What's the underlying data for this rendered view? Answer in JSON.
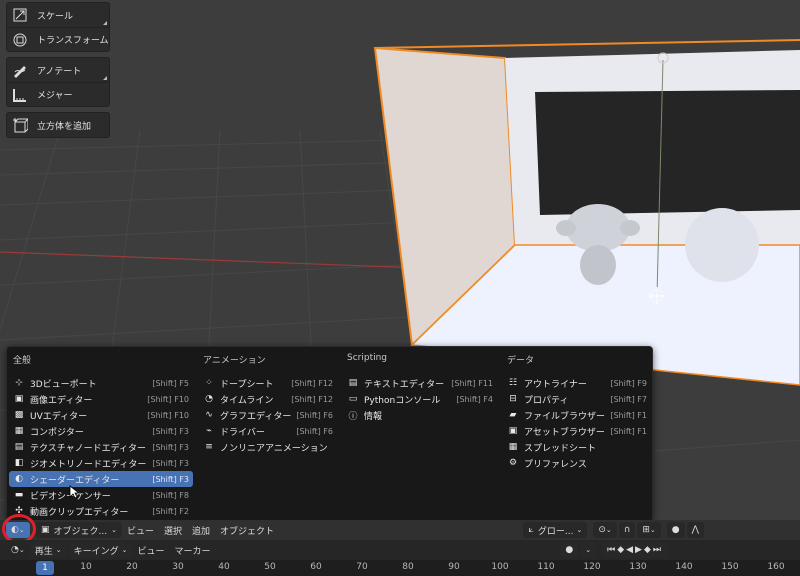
{
  "toolshelf": {
    "scale": "スケール",
    "transform": "トランスフォーム",
    "annotate": "アノテート",
    "measure": "メジャー",
    "add_cube": "立方体を追加"
  },
  "editor_menu": {
    "general": {
      "title": "全般",
      "items": [
        {
          "label": "3Dビューポート",
          "shortcut": "[Shift] F5"
        },
        {
          "label": "画像エディター",
          "shortcut": "[Shift] F10"
        },
        {
          "label": "UVエディター",
          "shortcut": "[Shift] F10"
        },
        {
          "label": "コンポジター",
          "shortcut": "[Shift] F3"
        },
        {
          "label": "テクスチャノードエディター",
          "shortcut": "[Shift] F3"
        },
        {
          "label": "ジオメトリノードエディター",
          "shortcut": "[Shift] F3"
        },
        {
          "label": "シェーダーエディター",
          "shortcut": "[Shift] F3"
        },
        {
          "label": "ビデオシーケンサー",
          "shortcut": "[Shift] F8"
        },
        {
          "label": "動画クリップエディター",
          "shortcut": "[Shift] F2"
        }
      ]
    },
    "animation": {
      "title": "アニメーション",
      "items": [
        {
          "label": "ドープシート",
          "shortcut": "[Shift] F12"
        },
        {
          "label": "タイムライン",
          "shortcut": "[Shift] F12"
        },
        {
          "label": "グラフエディター",
          "shortcut": "[Shift] F6"
        },
        {
          "label": "ドライバー",
          "shortcut": "[Shift] F6"
        },
        {
          "label": "ノンリニアアニメーション",
          "shortcut": ""
        }
      ]
    },
    "scripting": {
      "title": "Scripting",
      "items": [
        {
          "label": "テキストエディター",
          "shortcut": "[Shift] F11"
        },
        {
          "label": "Pythonコンソール",
          "shortcut": "[Shift] F4"
        },
        {
          "label": "情報",
          "shortcut": ""
        }
      ]
    },
    "data": {
      "title": "データ",
      "items": [
        {
          "label": "アウトライナー",
          "shortcut": "[Shift] F9"
        },
        {
          "label": "プロパティ",
          "shortcut": "[Shift] F7"
        },
        {
          "label": "ファイルブラウザー",
          "shortcut": "[Shift] F1"
        },
        {
          "label": "アセットブラウザー",
          "shortcut": "[Shift] F1"
        },
        {
          "label": "スプレッドシート",
          "shortcut": ""
        },
        {
          "label": "プリファレンス",
          "shortcut": ""
        }
      ]
    }
  },
  "header": {
    "mode": "オブジェク...",
    "view": "ビュー",
    "select": "選択",
    "add": "追加",
    "object": "オブジェクト",
    "transform_orientation": "グロー..."
  },
  "timeline": {
    "playback": "再生",
    "keying": "キーイング",
    "view": "ビュー",
    "marker": "マーカー",
    "current_frame": "1",
    "ticks": [
      "10",
      "20",
      "30",
      "40",
      "50",
      "60",
      "70",
      "80",
      "90",
      "100",
      "110",
      "120",
      "130",
      "140",
      "150",
      "160"
    ]
  },
  "colors": {
    "accent": "#4772b3",
    "selection_outline": "#f08a24",
    "highlight_circle": "#e0202a"
  }
}
